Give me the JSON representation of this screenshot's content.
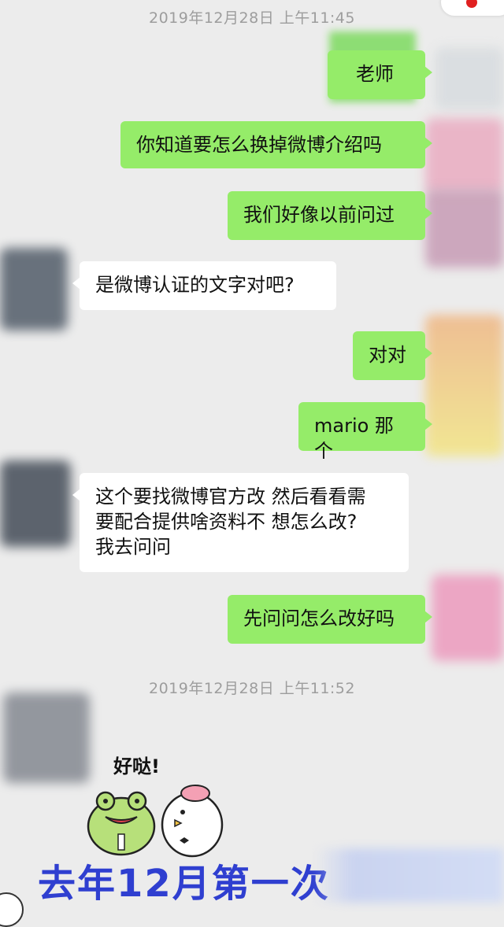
{
  "chat": {
    "timestamp_1": "2019年12月28日 上午11:45",
    "timestamp_2": "2019年12月28日 上午11:52",
    "messages": [
      {
        "side": "sent",
        "text": "老师"
      },
      {
        "side": "sent",
        "text": "你知道要怎么换掉微博介绍吗"
      },
      {
        "side": "sent",
        "text": "我们好像以前问过"
      },
      {
        "side": "received",
        "text": "是微博认证的文字对吧?"
      },
      {
        "side": "sent",
        "text": "对对"
      },
      {
        "side": "sent",
        "text": "mario 那个"
      },
      {
        "side": "received",
        "lines": [
          "这个要找微博官方改 然后看看需",
          "要配合提供啥资料不 想怎么改?",
          "我去问问"
        ]
      },
      {
        "side": "sent",
        "text": "先问问怎么改好吗"
      }
    ],
    "sticker_text": "好哒!"
  },
  "caption": {
    "text": "去年12月第一次"
  },
  "colors": {
    "background": "#ececec",
    "sent_bubble": "#95ec69",
    "received_bubble": "#ffffff",
    "timestamp": "#9d9d9d",
    "caption": "#2f3fd0"
  }
}
